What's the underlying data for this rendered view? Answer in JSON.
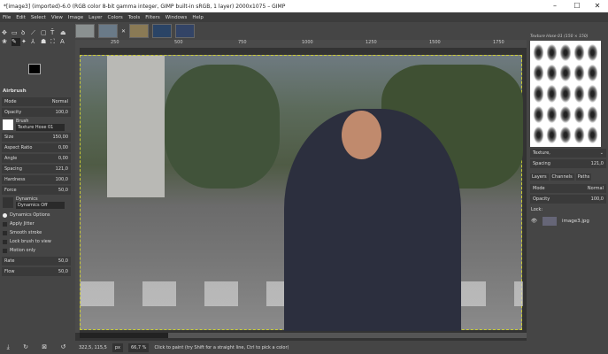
{
  "window": {
    "title": "*[image3] (imported)-6.0 (RGB color 8-bit gamma integer, GIMP built-in sRGB, 1 layer) 2000x1075 – GIMP",
    "minimize": "–",
    "maximize": "☐",
    "close": "✕"
  },
  "menu": [
    "File",
    "Edit",
    "Select",
    "View",
    "Image",
    "Layer",
    "Colors",
    "Tools",
    "Filters",
    "Windows",
    "Help"
  ],
  "image_tabs": [
    {
      "thumb": "#8a9090"
    },
    {
      "thumb": "#6a7a88",
      "close": "✕"
    },
    {
      "thumb": "#8a7a55"
    },
    {
      "thumb": "#2a4466"
    },
    {
      "thumb": "#334466"
    }
  ],
  "tools": [
    "✥",
    "▭",
    "ꝺ",
    "⟋",
    "▢",
    "T̄",
    "⏏",
    "❀",
    "✎",
    "✦",
    "⅄",
    "☗",
    "⛶",
    "A"
  ],
  "tool_options": {
    "title": "Airbrush",
    "mode_label": "Mode",
    "mode_value": "Normal",
    "opacity_label": "Opacity",
    "opacity_value": "100,0",
    "brush_label": "Brush",
    "brush_value": "Texture Hose 01",
    "size_label": "Size",
    "size_value": "150,00",
    "aspect_label": "Aspect Ratio",
    "aspect_value": "0,00",
    "angle_label": "Angle",
    "angle_value": "0,00",
    "spacing_label": "Spacing",
    "spacing_value": "121,0",
    "hardness_label": "Hardness",
    "hardness_value": "100,0",
    "force_label": "Force",
    "force_value": "50,0",
    "dynamics_label": "Dynamics",
    "dynamics_value": "Dynamics Off",
    "dynamics_options": "Dynamics Options",
    "apply_jitter": "Apply Jitter",
    "smooth_stroke": "Smooth stroke",
    "lock_brush": "Lock brush to view",
    "motion_only": "Motion only",
    "rate_label": "Rate",
    "rate_value": "50,0",
    "flow_label": "Flow",
    "flow_value": "50,0"
  },
  "rulers": [
    "250",
    "500",
    "750",
    "1000",
    "1250",
    "1500",
    "1750"
  ],
  "status": {
    "coords": "322,5, 115,5",
    "unit": "px",
    "zoom": "66,7 %",
    "message": "Click to paint (try Shift for a straight line, Ctrl to pick a color)"
  },
  "brushes": {
    "header": "Texture Hose 01 (150 × 150)",
    "category": "Texture,",
    "spacing_label": "Spacing",
    "spacing_value": "121,0"
  },
  "layers": {
    "tabs": [
      "Layers",
      "Channels",
      "Paths"
    ],
    "mode_label": "Mode",
    "mode_value": "Normal",
    "opacity_label": "Opacity",
    "opacity_value": "100,0",
    "lock_label": "Lock:",
    "layer_name": "image3.jpg"
  }
}
